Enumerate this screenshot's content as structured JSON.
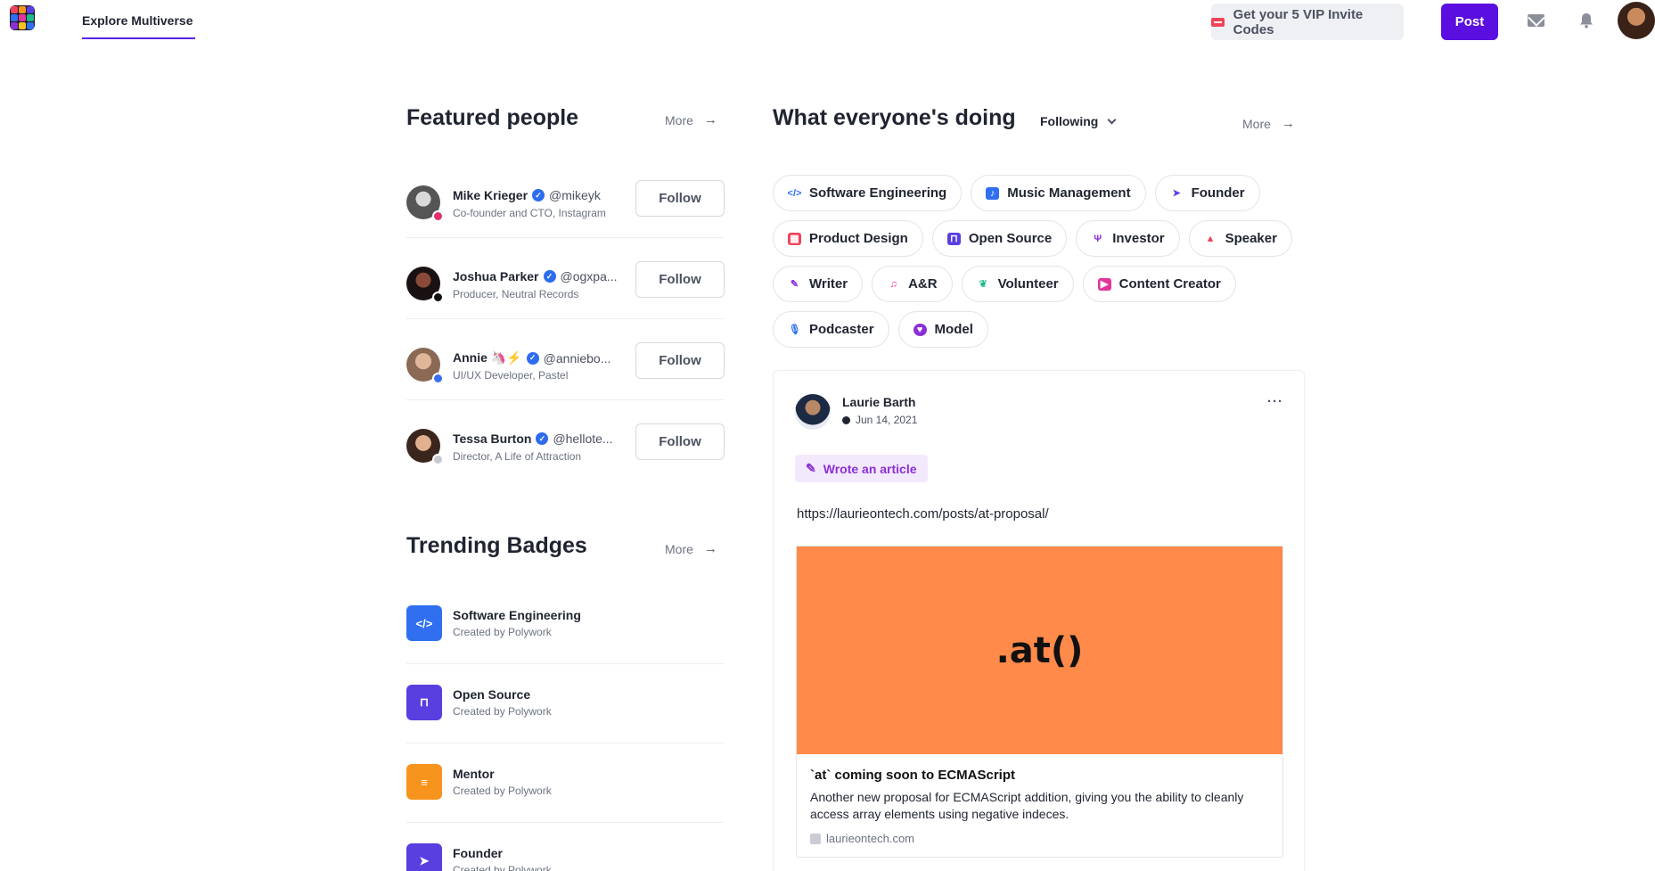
{
  "header": {
    "nav_tab": "Explore Multiverse",
    "invite_label": "Get your 5 VIP Invite Codes",
    "post_label": "Post",
    "brand_accent": "#5b0ee0"
  },
  "featured": {
    "title": "Featured people",
    "more_label": "More",
    "people": [
      {
        "name": "Mike Krieger",
        "handle": "@mikeyk",
        "title": "Co-founder and CTO, Instagram",
        "follow": "Follow",
        "badge_icon": "instagram-icon"
      },
      {
        "name": "Joshua Parker",
        "handle": "@ogxpa...",
        "title": "Producer, Neutral Records",
        "follow": "Follow",
        "badge_icon": "music-icon"
      },
      {
        "name": "Annie 🦄⚡",
        "handle": "@anniebo...",
        "title": "UI/UX Developer, Pastel",
        "follow": "Follow",
        "badge_icon": "globe-icon"
      },
      {
        "name": "Tessa Burton",
        "handle": "@hellote...",
        "title": "Director, A Life of Attraction",
        "follow": "Follow",
        "badge_icon": "circle-icon"
      }
    ]
  },
  "trending": {
    "title": "Trending Badges",
    "more_label": "More",
    "badges": [
      {
        "name": "Software Engineering",
        "creator": "Created by Polywork",
        "color": "#2f6ff0",
        "icon": "code-icon"
      },
      {
        "name": "Open Source",
        "creator": "Created by Polywork",
        "color": "#5a3fe0",
        "icon": "unlock-icon"
      },
      {
        "name": "Mentor",
        "creator": "Created by Polywork",
        "color": "#f7941d",
        "icon": "mentor-icon"
      },
      {
        "name": "Founder",
        "creator": "Created by Polywork",
        "color": "#5a3fe0",
        "icon": "rocket-icon"
      }
    ]
  },
  "activity": {
    "title": "What everyone's doing",
    "filter_label": "Following",
    "more_label": "More",
    "chips": [
      {
        "label": "Software Engineering",
        "icon": "code-icon",
        "color": "#2f6ff0"
      },
      {
        "label": "Music Management",
        "icon": "chat-icon",
        "color": "#2f6ff0"
      },
      {
        "label": "Founder",
        "icon": "rocket-icon",
        "color": "#5a3fe0"
      },
      {
        "label": "Product Design",
        "icon": "design-icon",
        "color": "#f0435b"
      },
      {
        "label": "Open Source",
        "icon": "unlock-icon",
        "color": "#5a3fe0"
      },
      {
        "label": "Investor",
        "icon": "sprout-icon",
        "color": "#8b2fd6"
      },
      {
        "label": "Speaker",
        "icon": "podium-icon",
        "color": "#f0435b"
      },
      {
        "label": "Writer",
        "icon": "pen-icon",
        "color": "#8b2fd6"
      },
      {
        "label": "A&R",
        "icon": "music-note-icon",
        "color": "#e0359a"
      },
      {
        "label": "Volunteer",
        "icon": "hands-icon",
        "color": "#1fb88a"
      },
      {
        "label": "Content Creator",
        "icon": "video-icon",
        "color": "#e0359a"
      },
      {
        "label": "Podcaster",
        "icon": "mic-icon",
        "color": "#2f6ff0"
      },
      {
        "label": "Model",
        "icon": "heart-icon",
        "color": "#8b2fd6"
      }
    ]
  },
  "post": {
    "author": "Laurie Barth",
    "date": "Jun 14, 2021",
    "menu": "···",
    "activity_tag": "Wrote an article",
    "url": "https://laurieontech.com/posts/at-proposal/",
    "preview": {
      "image_text": ".at()",
      "title": "`at` coming soon to ECMAScript",
      "description": "Another new proposal for ECMAScript addition, giving you the ability to cleanly access array elements using negative indeces.",
      "domain": "laurieontech.com",
      "image_color": "#ff8a4a"
    }
  }
}
